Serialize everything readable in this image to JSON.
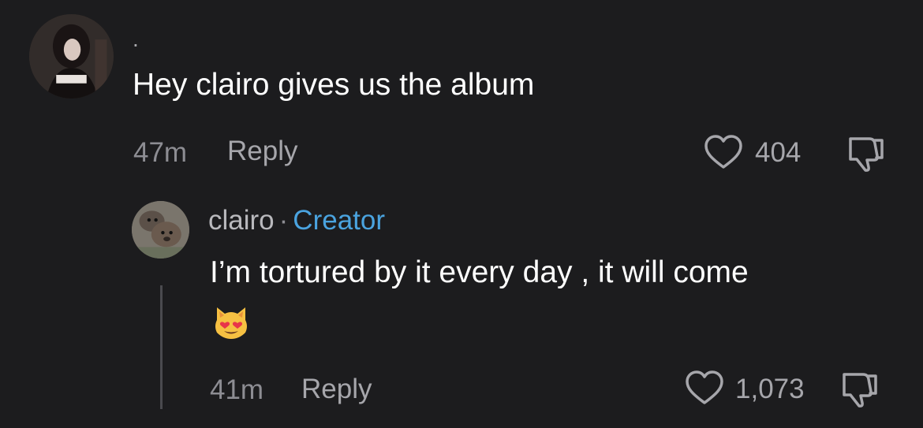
{
  "comment": {
    "username": ".",
    "text": "Hey clairo gives us the album",
    "time": "47m",
    "reply_label": "Reply",
    "likes": "404"
  },
  "reply": {
    "username": "clairo",
    "separator": "·",
    "badge": "Creator",
    "text": "I’m tortured by it every day , it will come",
    "emoji": "smiling-cat-heart-eyes",
    "time": "41m",
    "reply_label": "Reply",
    "likes": "1,073"
  },
  "colors": {
    "background": "#1c1c1e",
    "creator_badge": "#4aa3df",
    "muted_text": "#8d8d93"
  },
  "icons": {
    "like": "heart-outline-icon",
    "dislike": "thumbs-down-outline-icon"
  }
}
